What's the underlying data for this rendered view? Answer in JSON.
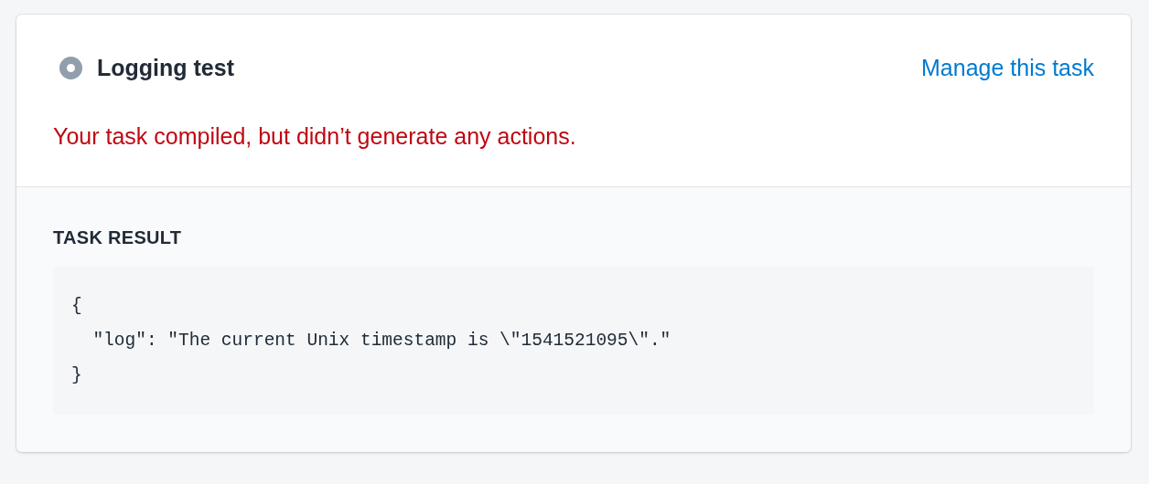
{
  "task": {
    "title": "Logging test",
    "manage_link": "Manage this task"
  },
  "message": "Your task compiled, but didn’t generate any actions.",
  "result": {
    "heading": "TASK RESULT",
    "code_lines": [
      "{",
      "  \"log\": \"The current Unix timestamp is \\\"1541521095\\\".\"",
      "}"
    ]
  }
}
